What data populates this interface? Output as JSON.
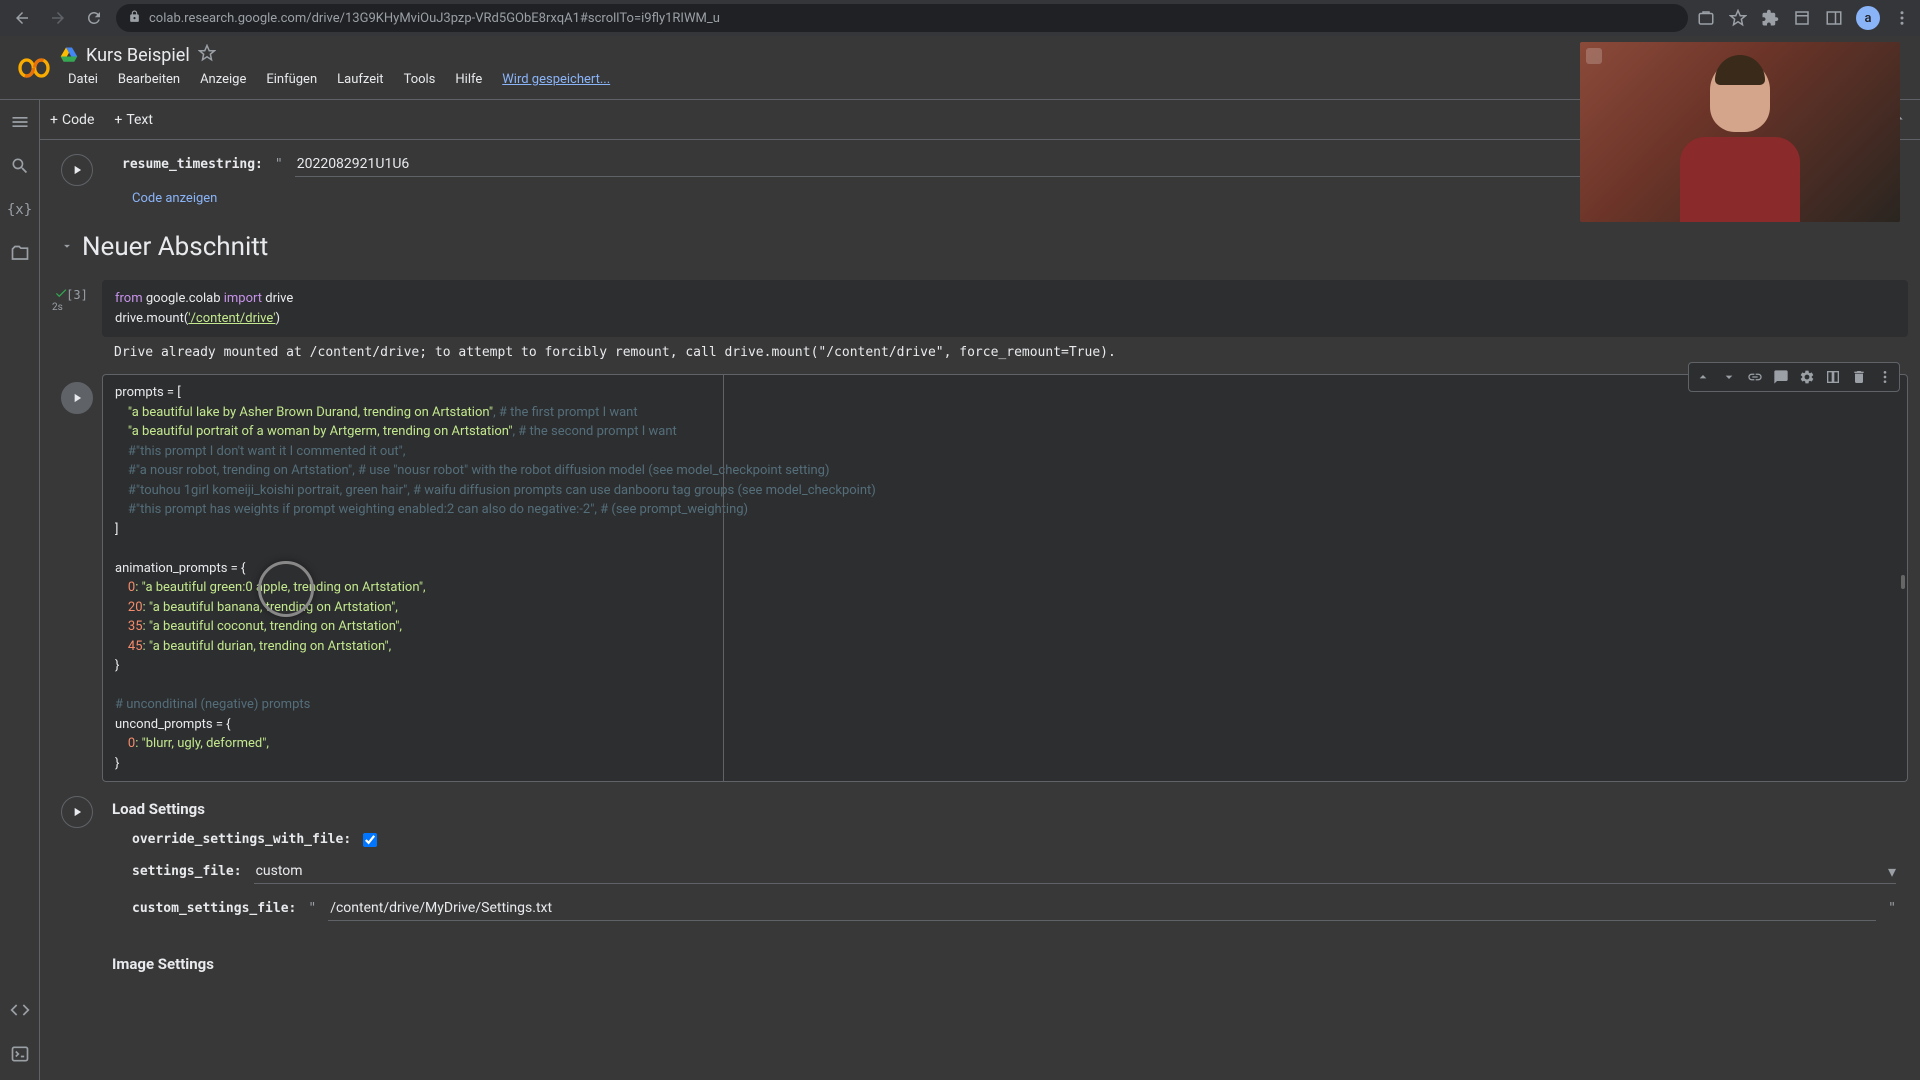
{
  "browser": {
    "url": "colab.research.google.com/drive/13G9KHyMviOuJ3pzp-VRd5GObE8rxqA1#scrollTo=i9fly1RIWM_u",
    "avatar_letter": "a"
  },
  "header": {
    "title": "Kurs Beispiel",
    "menu": [
      "Datei",
      "Bearbeiten",
      "Anzeige",
      "Einfügen",
      "Laufzeit",
      "Tools",
      "Hilfe"
    ],
    "saving": "Wird gespeichert..."
  },
  "toolbar": {
    "code": "Code",
    "text": "Text"
  },
  "cells": {
    "resume": {
      "label": "resume_timestring:",
      "value": "2022082921U1U6",
      "show_code": "Code anzeigen"
    },
    "section": "Neuer Abschnitt",
    "cell3": {
      "exec_count": "[3]",
      "exec_time": "2s",
      "code_line1_from": "from",
      "code_line1_mod": " google.colab ",
      "code_line1_import": "import",
      "code_line1_drive": " drive",
      "code_line2_pre": "drive.mount(",
      "code_line2_str": "'/content/drive'",
      "code_line2_post": ")",
      "output": "Drive already mounted at /content/drive; to attempt to forcibly remount, call drive.mount(\"/content/drive\", force_remount=True)."
    },
    "prompts_code": {
      "l1": "prompts = [",
      "l2_s": "    \"a beautiful lake by Asher Brown Durand, trending on Artstation\"",
      "l2_c": ", # the first prompt I want",
      "l3_s": "    \"a beautiful portrait of a woman by Artgerm, trending on Artstation\"",
      "l3_c": ", # the second prompt I want",
      "l4": "    #\"this prompt I don't want it I commented it out\",",
      "l5": "    #\"a nousr robot, trending on Artstation\", # use \"nousr robot\" with the robot diffusion model (see model_checkpoint setting)",
      "l6": "    #\"touhou 1girl komeiji_koishi portrait, green hair\", # waifu diffusion prompts can use danbooru tag groups (see model_checkpoint)",
      "l7": "    #\"this prompt has weights if prompt weighting enabled:2 can also do negative:-2\", # (see prompt_weighting)",
      "l8": "]",
      "l9": "",
      "l10": "animation_prompts = {",
      "l11_k": "    0",
      "l11_s": ": \"a beautiful green:0 apple, trending on Artstation\",",
      "l12_k": "    20",
      "l12_s": ": \"a beautiful banana, trending on Artstation\",",
      "l13_k": "    35",
      "l13_s": ": \"a beautiful coconut, trending on Artstation\",",
      "l14_k": "    45",
      "l14_s": ": \"a beautiful durian, trending on Artstation\",",
      "l15": "}",
      "l16": "",
      "l17": "# unconditinal (negative) prompts",
      "l18": "uncond_prompts = {",
      "l19_k": "    0",
      "l19_s": ": \"blurr, ugly, deformed\",",
      "l20": "}"
    },
    "load_settings": {
      "heading": "Load Settings",
      "override_label": "override_settings_with_file:",
      "settings_file_label": "settings_file:",
      "settings_file_value": "custom",
      "custom_label": "custom_settings_file:",
      "custom_value": "/content/drive/MyDrive/Settings.txt"
    },
    "image_settings": {
      "heading": "Image Settings"
    }
  }
}
